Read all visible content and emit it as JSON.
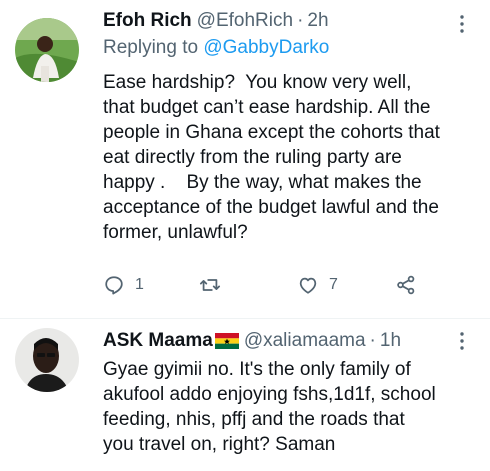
{
  "tweets": [
    {
      "name": "Efoh Rich",
      "handle": "@EfohRich",
      "time": "2h",
      "reply_prefix": "Replying to ",
      "reply_handle": "@GabbyDarko",
      "text": "Ease hardship?  You know very well,\nthat budget can’t ease hardship. All the\npeople in Ghana except the cohorts that\neat directly from the ruling party are\nhappy .    By the way, what makes the\nacceptance of the budget lawful and the\nformer, unlawful?",
      "reply_count": "1",
      "like_count": "7",
      "retweet_count": "",
      "icons": [
        "reply-icon",
        "retweet-icon",
        "like-icon",
        "share-icon",
        "more-icon"
      ]
    },
    {
      "name": "ASK Maama",
      "handle": "@xaliamaama",
      "time": "1h",
      "flag": "ghana-flag-emoji",
      "text": "Gyae gyimii no. It's the only family of\nakufool addo enjoying fshs,1d1f, school\nfeeding, nhis, pffj and the roads that\nyou travel on, right? Saman",
      "icons": [
        "more-icon"
      ]
    }
  ],
  "colors": {
    "link": "#1d9bf0",
    "secondary": "#536471",
    "divider": "#eff3f4"
  }
}
